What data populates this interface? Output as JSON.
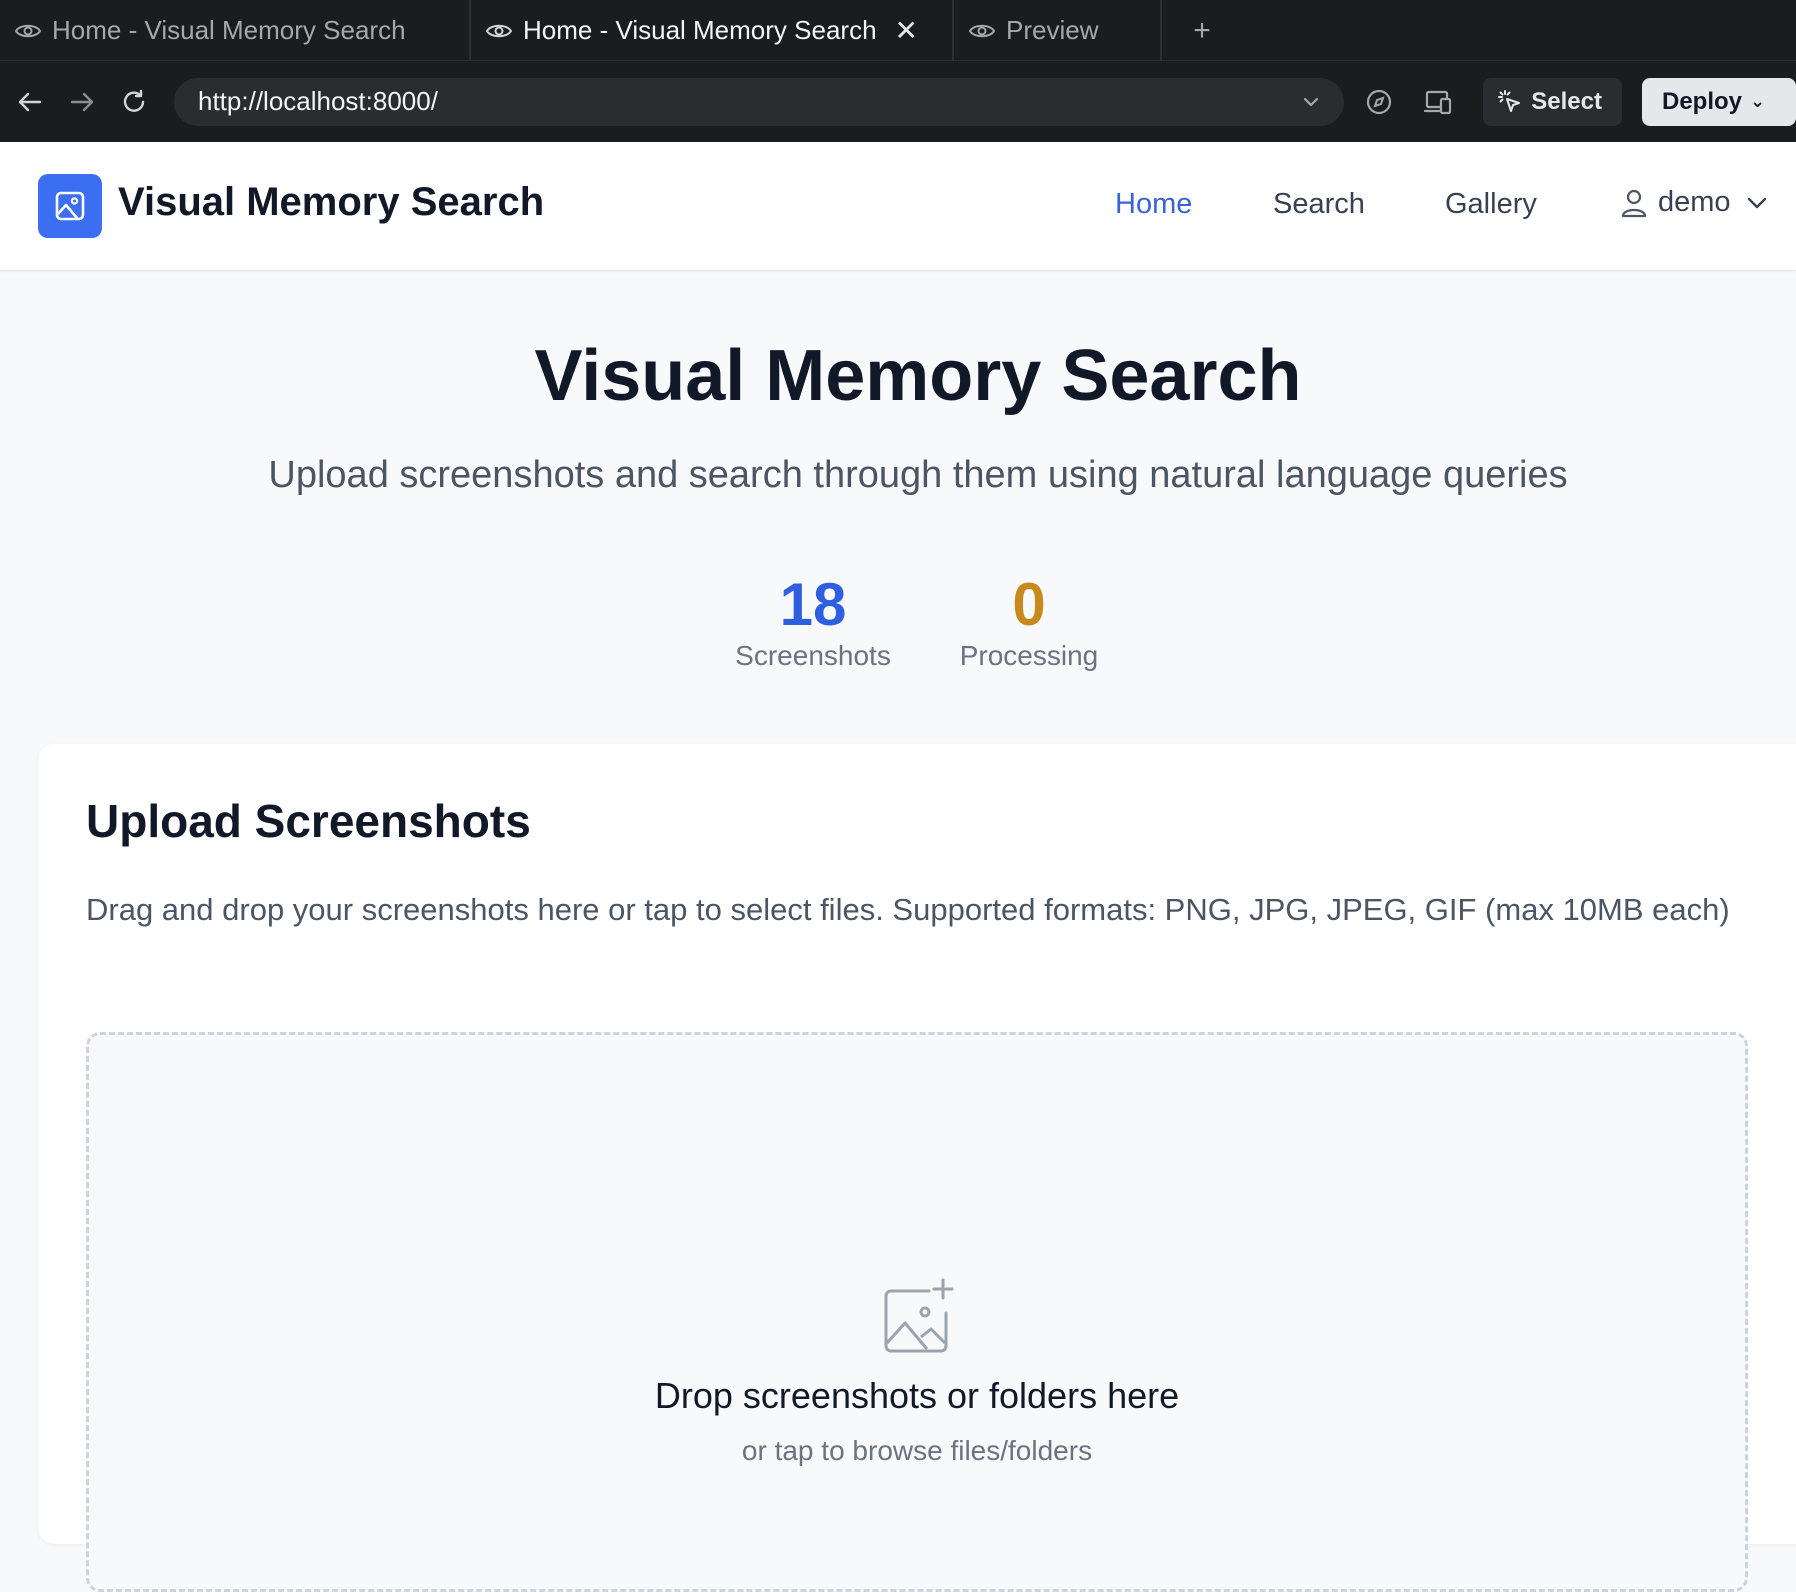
{
  "browser": {
    "tabs": [
      {
        "title": "Home - Visual Memory Search",
        "active": false,
        "icon": "eye-icon"
      },
      {
        "title": "Home - Visual Memory Search",
        "active": true,
        "icon": "eye-icon",
        "close": "✕"
      },
      {
        "title": "Preview",
        "active": false,
        "icon": "eye-icon"
      }
    ],
    "new_tab": "+",
    "url": "http://localhost:8000/",
    "select_label": "Select",
    "deploy_label": "Deploy"
  },
  "app": {
    "brand": "Visual Memory Search",
    "accent": "#3b6ef0",
    "nav": [
      {
        "label": "Home",
        "active": true
      },
      {
        "label": "Search",
        "active": false
      },
      {
        "label": "Gallery",
        "active": false
      }
    ],
    "user": "demo"
  },
  "hero": {
    "title": "Visual Memory Search",
    "subtitle": "Upload screenshots and search through them using natural language queries"
  },
  "stats": [
    {
      "value": "18",
      "label": "Screenshots",
      "color": "#2f5fe0"
    },
    {
      "value": "0",
      "label": "Processing",
      "color": "#c88a1d"
    }
  ],
  "upload": {
    "title": "Upload Screenshots",
    "description": "Drag and drop your screenshots here or tap to select files. Supported formats: PNG, JPG, JPEG, GIF (max 10MB each)",
    "drop_title": "Drop screenshots or folders here",
    "drop_subtitle": "or tap to browse files/folders"
  }
}
